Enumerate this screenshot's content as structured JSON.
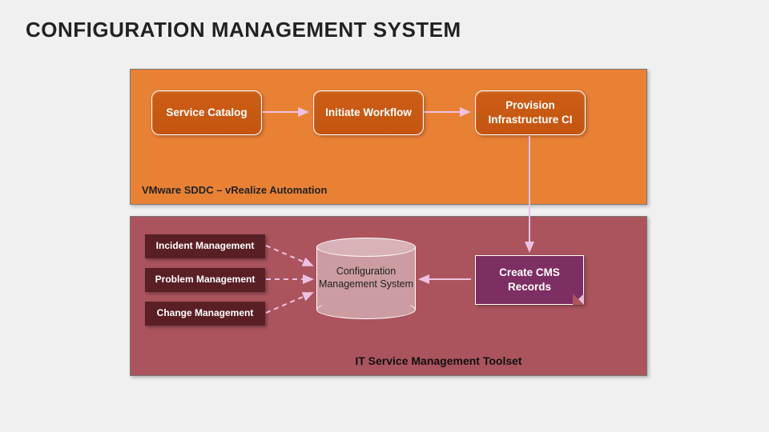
{
  "title": "CONFIGURATION MANAGEMENT SYSTEM",
  "panel_top": {
    "label": "VMware SDDC – vRealize Automation",
    "nodes": {
      "service_catalog": "Service Catalog",
      "initiate_workflow": "Initiate Workflow",
      "provision_ci": "Provision Infrastructure CI"
    }
  },
  "panel_bottom": {
    "label": "IT Service Management Toolset",
    "list": {
      "incident": "Incident Management",
      "problem": "Problem Management",
      "change": "Change Management"
    },
    "cylinder": "Configuration Management System",
    "note": "Create CMS Records"
  },
  "colors": {
    "top_panel": "#e98135",
    "bottom_panel": "#ab545e",
    "round_node": "#c35510",
    "dark_node": "#5a1f25",
    "note": "#7d2e63",
    "arrow": "#eec1e1"
  }
}
